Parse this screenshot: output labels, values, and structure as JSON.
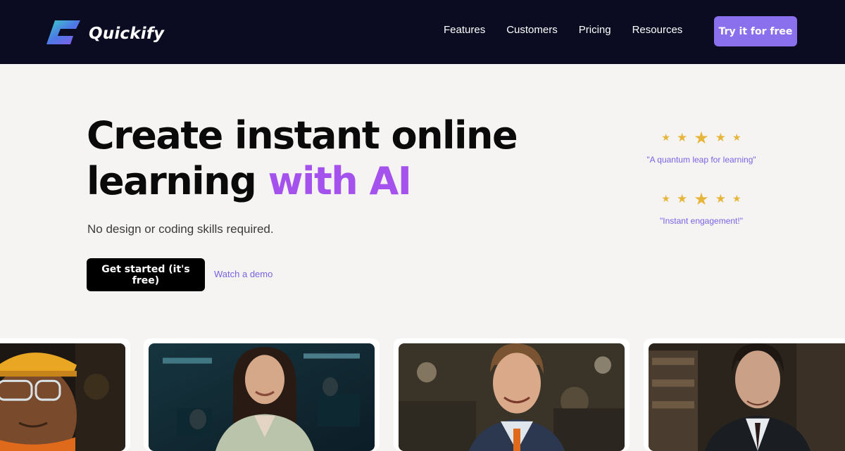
{
  "brand": {
    "name": "Quickify",
    "logo_icon": "quickify-logo-icon"
  },
  "nav": {
    "items": [
      "Features",
      "Customers",
      "Pricing",
      "Resources"
    ],
    "cta": "Try it for free"
  },
  "hero": {
    "headline_line1": "Create instant online",
    "headline_line2_plain": "learning ",
    "headline_line2_accent": "with AI",
    "subhead": "No design or coding skills required.",
    "primary_button": "Get started (it's free)",
    "secondary_link": "Watch a demo"
  },
  "reviews": [
    {
      "rating": 5,
      "quote": "\"A quantum leap for learning\""
    },
    {
      "rating": 5,
      "quote": "\"Instant engagement!\""
    }
  ],
  "photos": [
    {
      "subject": "worker-with-hard-hat"
    },
    {
      "subject": "woman-in-office"
    },
    {
      "subject": "smiling-man-in-vest"
    },
    {
      "subject": "man-in-suit"
    }
  ],
  "colors": {
    "topbar": "#0b0c22",
    "accent": "#a451ee",
    "button_purple": "#8a70ec",
    "link": "#7b62e3",
    "star": "#e6b53a",
    "background": "#f5f4f2"
  }
}
